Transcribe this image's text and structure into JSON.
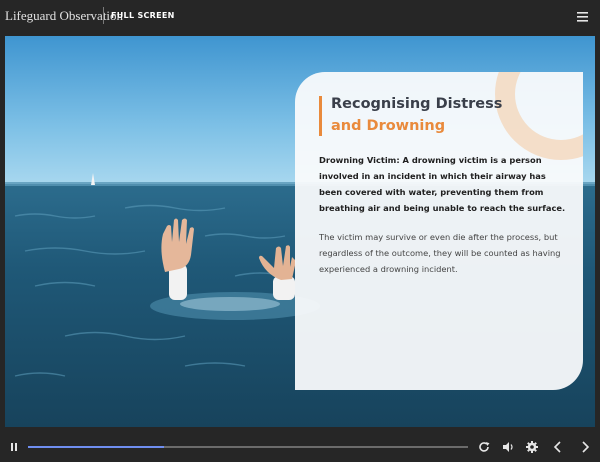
{
  "header": {
    "title": "Lifeguard Observation",
    "fullscreen_label": "FULL SCREEN",
    "menu_icon": "hamburger-menu-icon"
  },
  "slide": {
    "heading_line1": "Recognising Distress",
    "heading_line2": "and Drowning",
    "definition_term": "Drowning Victim:",
    "definition_text": " A drowning victim is a person involved in an incident in which their airway has been covered with water, preventing them from breathing air and being unable to reach the surface.",
    "body_text": "The victim may survive or even die after the process, but regardless of the outcome, they will be counted as having experienced a drowning incident."
  },
  "player": {
    "progress": 0.31,
    "icons": [
      "pause-icon",
      "replay-icon",
      "volume-icon",
      "settings-icon",
      "previous-icon",
      "next-icon"
    ]
  },
  "colors": {
    "accent": "#e98a3c",
    "heading": "#3a3f4a",
    "progress": "#6f8ef0",
    "chrome": "#262626"
  }
}
